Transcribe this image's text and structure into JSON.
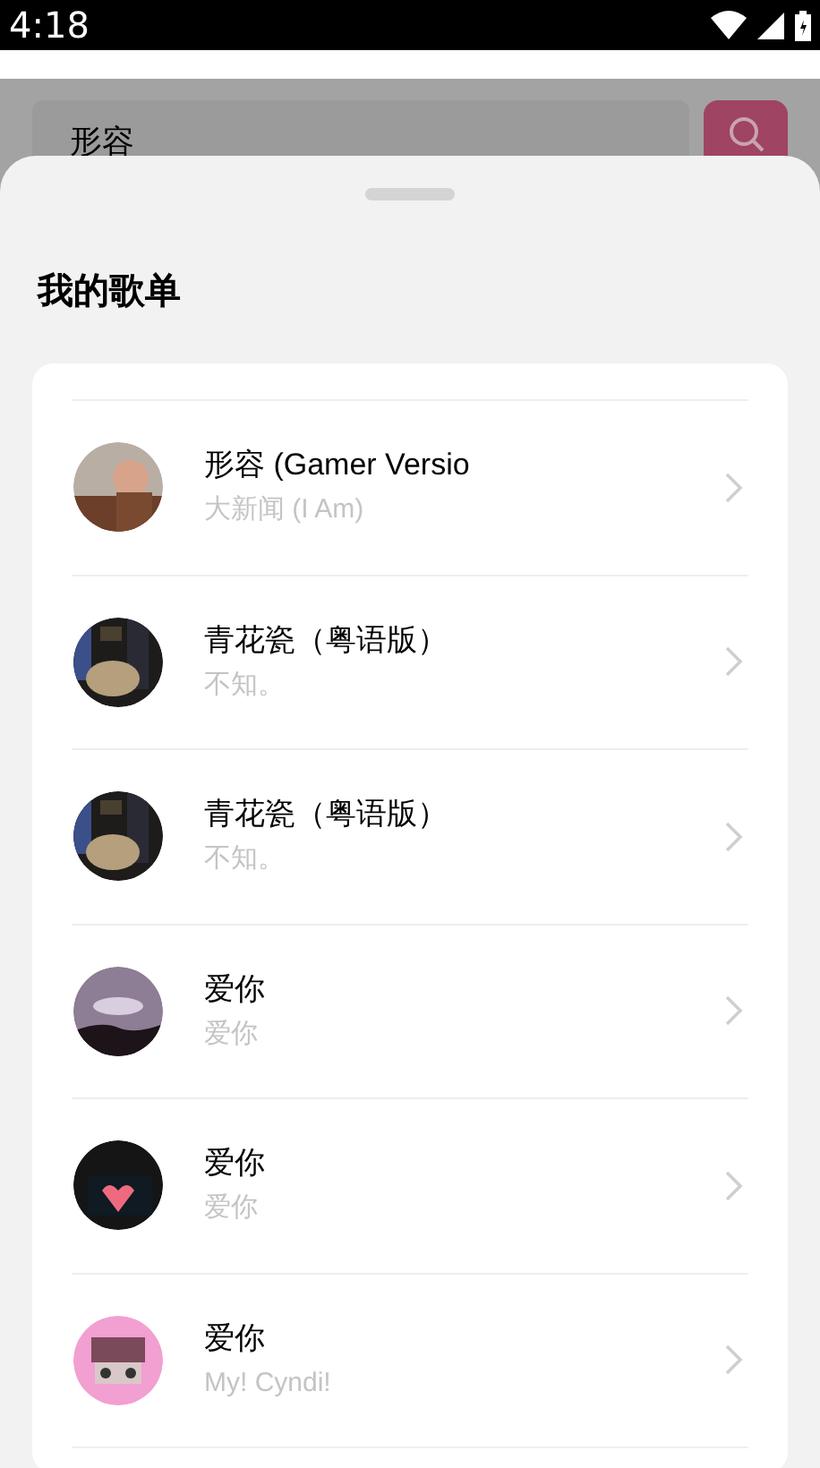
{
  "status_bar": {
    "time": "4:18"
  },
  "search": {
    "value": "形容"
  },
  "sheet": {
    "title": "我的歌单"
  },
  "songs": [
    {
      "title": "形容 (Gamer Versio",
      "subtitle": "大新闻 (I Am)"
    },
    {
      "title": "青花瓷（粤语版）",
      "subtitle": "不知。"
    },
    {
      "title": "青花瓷（粤语版）",
      "subtitle": "不知。"
    },
    {
      "title": "爱你",
      "subtitle": "爱你"
    },
    {
      "title": "爱你",
      "subtitle": "爱你"
    },
    {
      "title": "爱你",
      "subtitle": "My! Cyndi!"
    }
  ]
}
